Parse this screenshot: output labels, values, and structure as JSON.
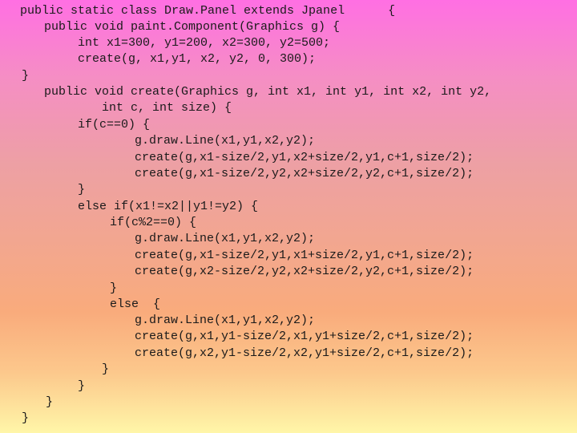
{
  "slide": {
    "background_colors": {
      "top": "#ff6fe3",
      "middle": "#f3a78d",
      "bottom": "#fff6a8"
    },
    "text_color": "#1a1a1a",
    "code_lines": [
      "public static class Draw.Panel extends Jpanel      {",
      "public void paint.Component(Graphics g) {",
      "int x1=300, y1=200, x2=300, y2=500;",
      "create(g, x1,y1, x2, y2, 0, 300);",
      "}",
      "public void create(Graphics g, int x1, int y1, int x2, int y2,",
      "int c, int size) {",
      "if(c==0) {",
      "g.draw.Line(x1,y1,x2,y2);",
      "create(g,x1-size/2,y1,x2+size/2,y1,c+1,size/2);",
      "create(g,x1-size/2,y2,x2+size/2,y2,c+1,size/2);",
      "}",
      "else if(x1!=x2||y1!=y2) {",
      "if(c%2==0) {",
      "g.draw.Line(x1,y1,x2,y2);",
      "create(g,x1-size/2,y1,x1+size/2,y1,c+1,size/2);",
      "create(g,x2-size/2,y2,x2+size/2,y2,c+1,size/2);",
      "}",
      "else  {",
      "g.draw.Line(x1,y1,x2,y2);",
      "create(g,x1,y1-size/2,x1,y1+size/2,c+1,size/2);",
      "create(g,x2,y1-size/2,x2,y1+size/2,c+1,size/2);",
      "}",
      "}",
      "}",
      "}"
    ]
  }
}
